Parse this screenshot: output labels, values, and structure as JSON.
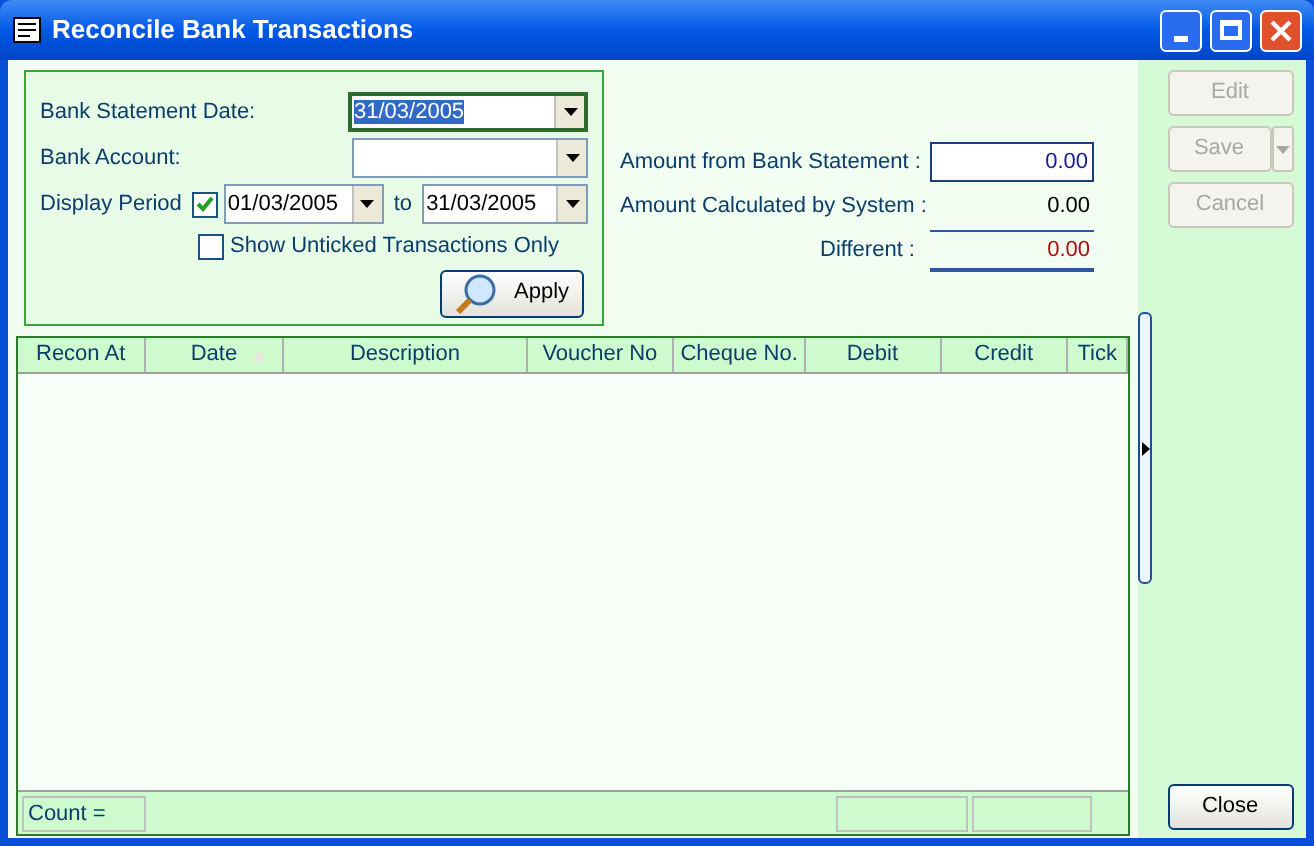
{
  "window": {
    "title": "Reconcile Bank Transactions"
  },
  "filter": {
    "statement_date_label": "Bank Statement Date:",
    "statement_date": "31/03/2005",
    "bank_account_label": "Bank Account:",
    "display_period_label": "Display Period",
    "display_period_checked": true,
    "period_from": "01/03/2005",
    "to_label": "to",
    "period_to": "31/03/2005",
    "unticked_only_label": "Show Unticked Transactions Only",
    "unticked_only_checked": false,
    "apply": "Apply"
  },
  "amounts": {
    "from_statement_label": "Amount from  Bank Statement :",
    "from_statement": "0.00",
    "calculated_label": "Amount Calculated by System :",
    "calculated": "0.00",
    "different_label": "Different :",
    "different": "0.00"
  },
  "table": {
    "columns": [
      {
        "label": "Recon At",
        "sorted": false
      },
      {
        "label": "Date",
        "sorted": true
      },
      {
        "label": "Description",
        "sorted": false
      },
      {
        "label": "Voucher No",
        "sorted": false
      },
      {
        "label": "Cheque No.",
        "sorted": false
      },
      {
        "label": "Debit",
        "sorted": false
      },
      {
        "label": "Credit",
        "sorted": false
      },
      {
        "label": "Tick",
        "sorted": false
      }
    ],
    "count_label": "Count ="
  },
  "actions": [
    {
      "label": "Edit",
      "disabled": true,
      "dropdown": false
    },
    {
      "label": "Save",
      "disabled": true,
      "dropdown": true
    },
    {
      "label": "Cancel",
      "disabled": true,
      "dropdown": false
    }
  ],
  "close": "Close"
}
